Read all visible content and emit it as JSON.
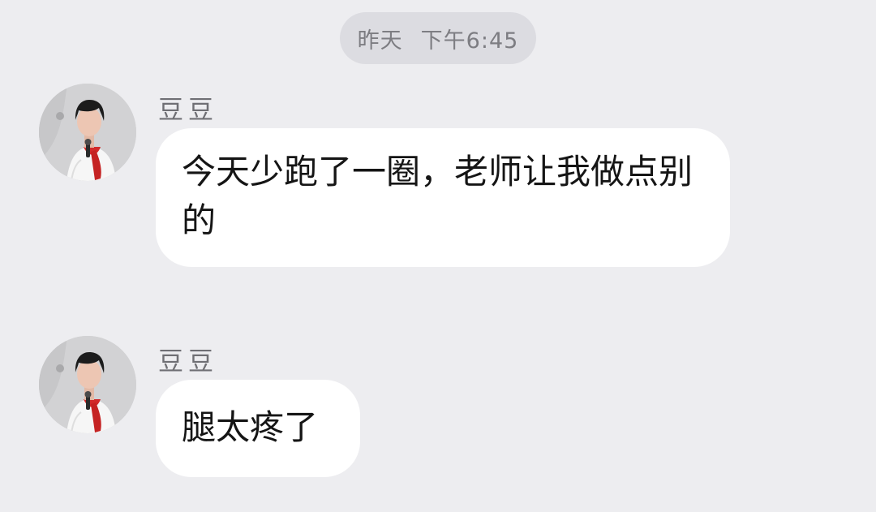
{
  "timestamp": {
    "day": "昨天",
    "time": "下午6:45"
  },
  "messages": [
    {
      "sender": "豆豆",
      "text": "今天少跑了一圈，老师让我做点别的",
      "avatar_icon": "child-avatar-icon"
    },
    {
      "sender": "豆豆",
      "text": "腿太疼了",
      "avatar_icon": "child-avatar-icon"
    }
  ],
  "colors": {
    "background": "#ededf0",
    "bubble": "#ffffff",
    "time_pill": "#dcdce1",
    "scarf": "#d22a2a"
  }
}
